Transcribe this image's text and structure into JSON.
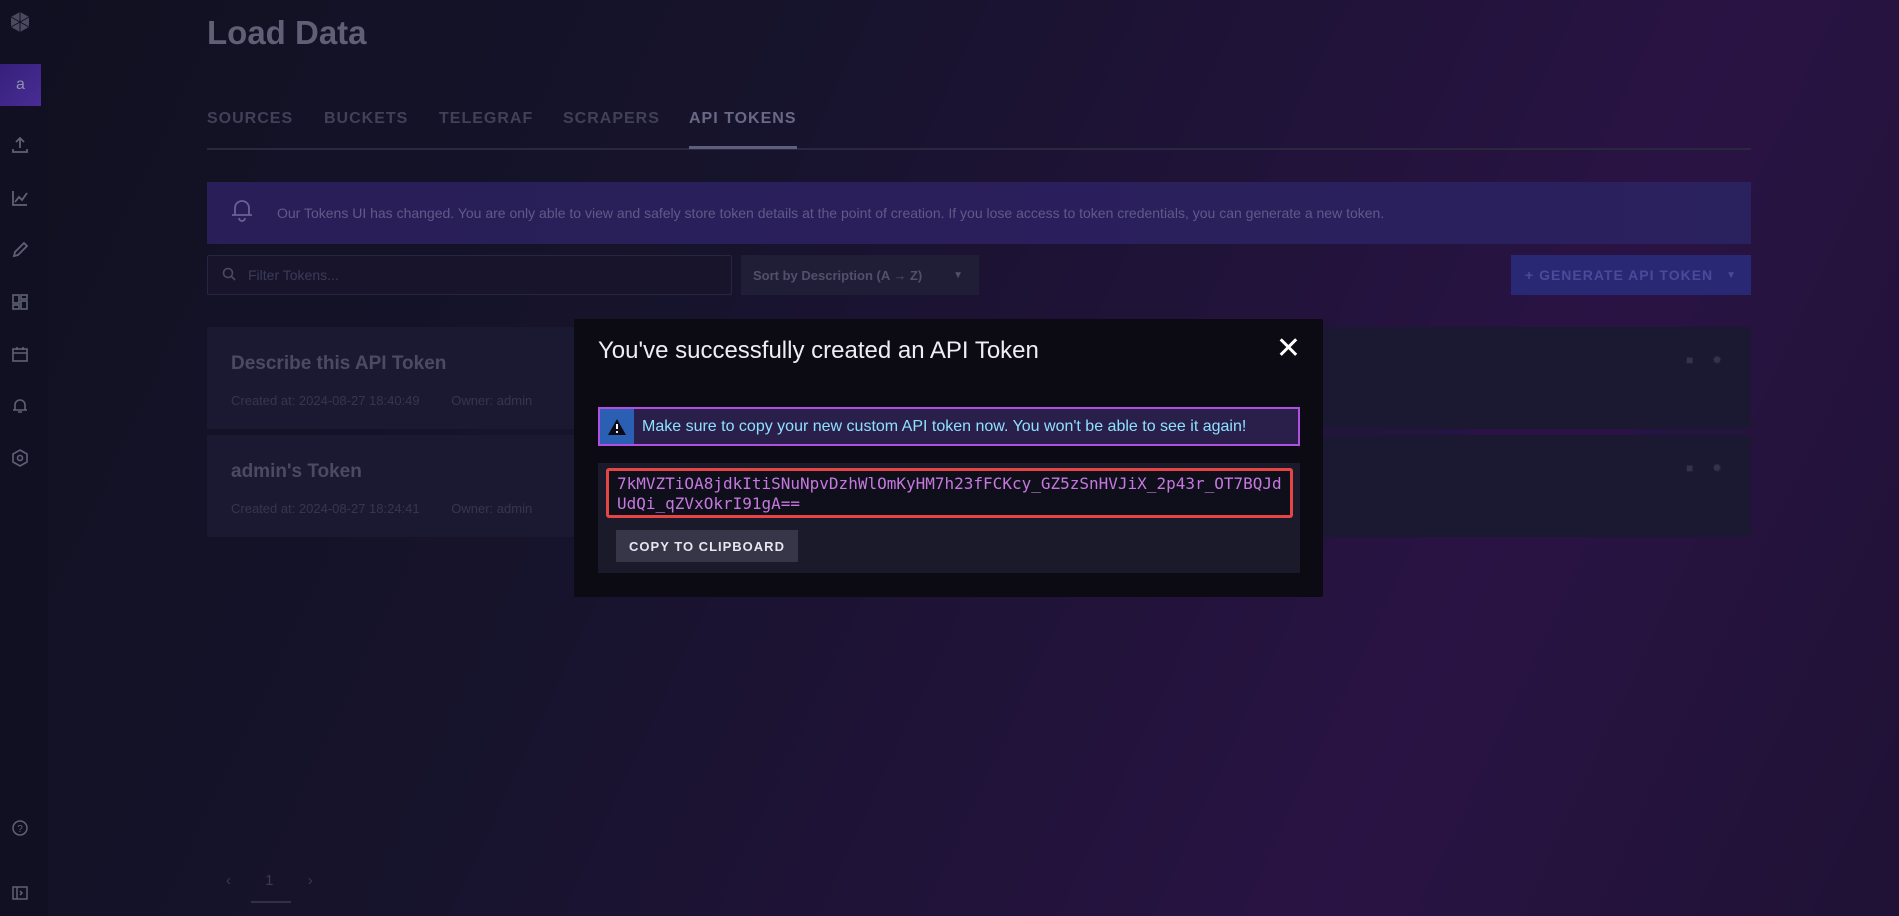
{
  "sidebar": {
    "org_initial": "a",
    "icons": [
      "influx-logo-icon",
      "upload-icon",
      "graph-icon",
      "pencil-icon",
      "dashboards-icon",
      "calendar-icon",
      "bell-icon",
      "gear-icon",
      "help-icon",
      "collapse-icon"
    ]
  },
  "page": {
    "title": "Load Data",
    "tabs": [
      "SOURCES",
      "BUCKETS",
      "TELEGRAF",
      "SCRAPERS",
      "API TOKENS"
    ],
    "active_tab": "API TOKENS"
  },
  "banner": {
    "message": "Our Tokens UI has changed. You are only able to view and safely store token details at the point of creation. If you lose access to token credentials, you can generate a new token."
  },
  "toolbar": {
    "filter_placeholder": "Filter Tokens...",
    "sort_label": "Sort by Description (A → Z)",
    "generate_label": "+ GENERATE API TOKEN"
  },
  "tokens": [
    {
      "name": "Describe this API Token",
      "created": "Created at: 2024-08-27 18:40:49",
      "owner": "Owner: admin"
    },
    {
      "name": "admin's Token",
      "created": "Created at: 2024-08-27 18:24:41",
      "owner": "Owner: admin"
    }
  ],
  "pager": {
    "current": "1"
  },
  "modal": {
    "title": "You've successfully created an API Token",
    "close": "✕",
    "alert": "Make sure to copy your new custom API token now. You won't be able to see it again!",
    "token": "7kMVZTiOA8jdkItiSNuNpvDzhWlOmKyHM7h23fFCKcy_GZ5zSnHVJiX_2p43r_OT7BQJdUdQi_qZVxOkrI91gA==",
    "copy_label": "COPY TO CLIPBOARD"
  }
}
